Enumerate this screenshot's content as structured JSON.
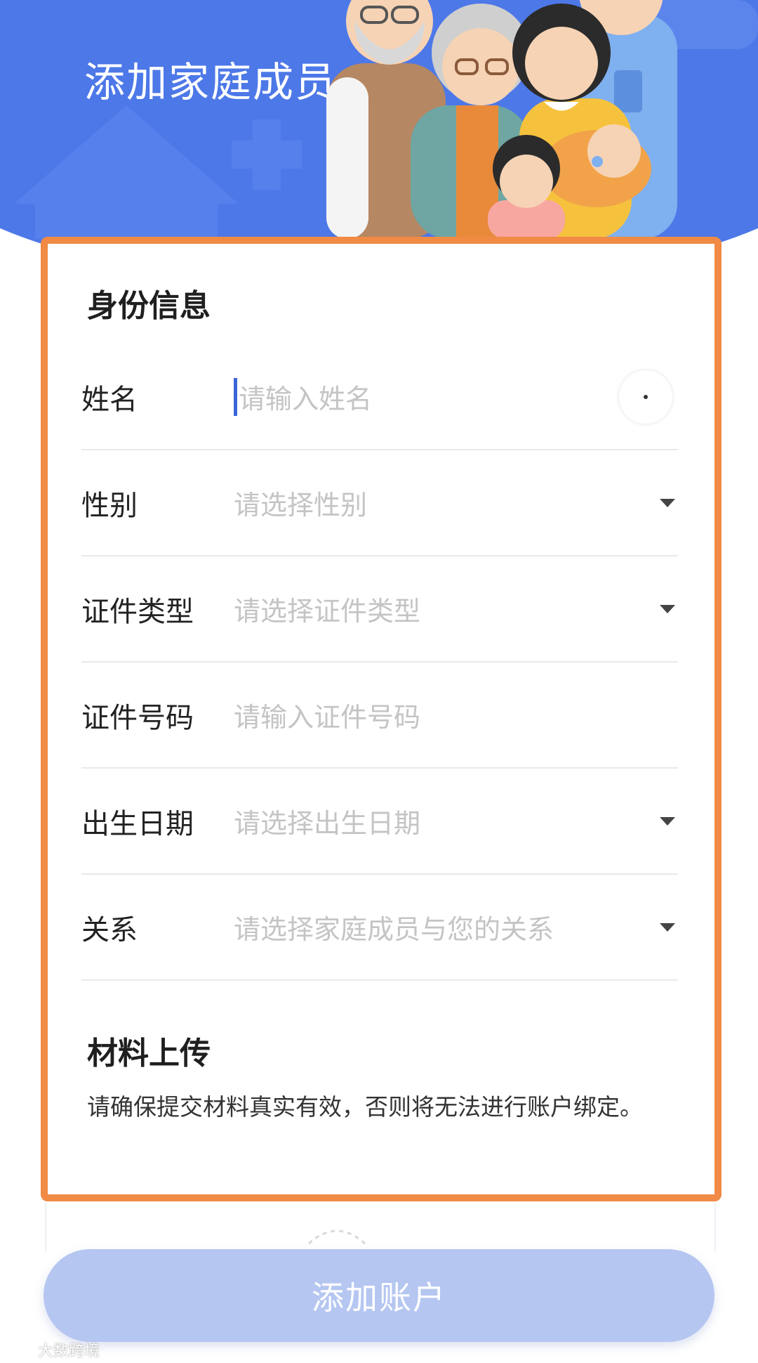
{
  "header": {
    "title": "添加家庭成员"
  },
  "identity_section": {
    "title": "身份信息",
    "fields": [
      {
        "label": "姓名",
        "placeholder": "请输入姓名",
        "type": "text"
      },
      {
        "label": "性别",
        "placeholder": "请选择性别",
        "type": "select"
      },
      {
        "label": "证件类型",
        "placeholder": "请选择证件类型",
        "type": "select"
      },
      {
        "label": "证件号码",
        "placeholder": "请输入证件号码",
        "type": "text"
      },
      {
        "label": "出生日期",
        "placeholder": "请选择出生日期",
        "type": "select"
      },
      {
        "label": "关系",
        "placeholder": "请选择家庭成员与您的关系",
        "type": "select"
      }
    ]
  },
  "upload_section": {
    "title": "材料上传",
    "note": "请确保提交材料真实有效，否则将无法进行账户绑定。"
  },
  "submit": {
    "label": "添加账户"
  },
  "watermark": {
    "text": "大数跨境"
  },
  "colors": {
    "header_blue": "#4d78e8",
    "highlight_orange": "#f08a45",
    "button_disabled": "#b5c6f1",
    "placeholder_gray": "#c4c4c4"
  },
  "icons": [
    "clear-input-icon",
    "dropdown-arrow-icon",
    "family-illustration",
    "watermark-logo"
  ]
}
